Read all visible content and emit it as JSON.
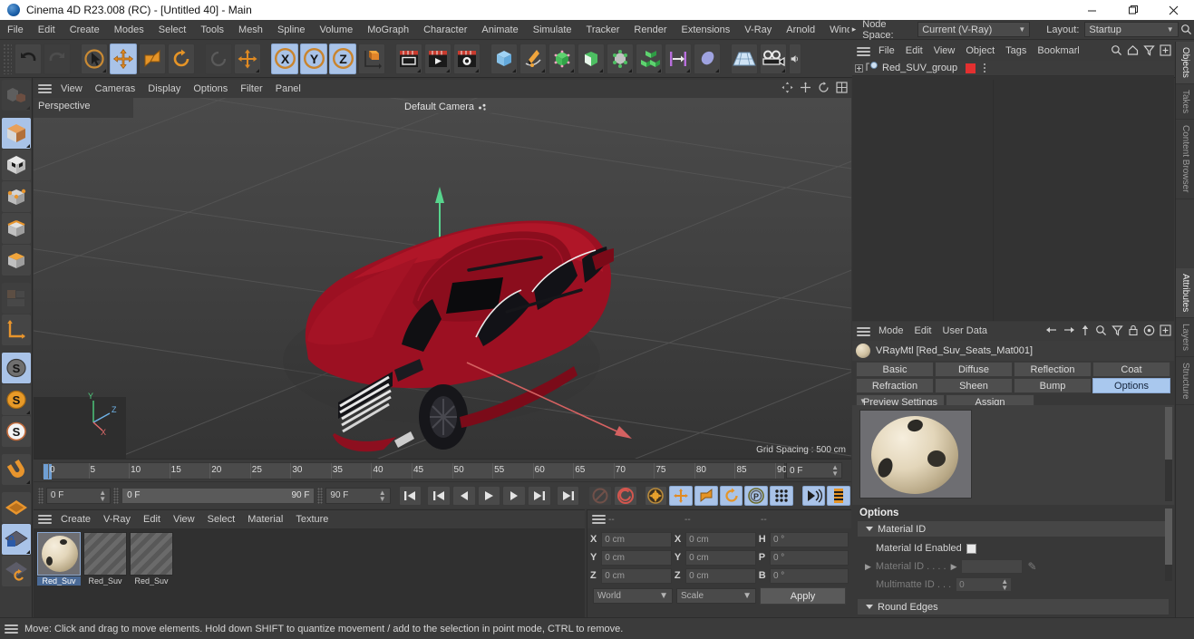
{
  "window": {
    "title": "Cinema 4D R23.008 (RC) - [Untitled 40] - Main",
    "minimize": "—",
    "maximize": "❐",
    "close": "✕"
  },
  "menubar": {
    "items": [
      "File",
      "Edit",
      "Create",
      "Modes",
      "Select",
      "Tools",
      "Mesh",
      "Spline",
      "Volume",
      "MoGraph",
      "Character",
      "Animate",
      "Simulate",
      "Tracker",
      "Render",
      "Extensions",
      "V-Ray",
      "Arnold",
      "Wind"
    ],
    "overflow_arrow": "▸",
    "node_space_label": "Node Space:",
    "node_space_value": "Current (V-Ray)",
    "layout_label": "Layout:",
    "layout_value": "Startup"
  },
  "toolbar": {
    "buttons": [
      {
        "name": "undo",
        "label": "Undo",
        "selected": false,
        "dim": false
      },
      {
        "name": "redo",
        "label": "Redo",
        "selected": false,
        "dim": true
      },
      {
        "name": "select-tool",
        "label": "Live Selection",
        "selected": false,
        "dim": false
      },
      {
        "name": "move-tool",
        "label": "Move",
        "selected": true,
        "dim": false
      },
      {
        "name": "scale-tool",
        "label": "Scale",
        "selected": false,
        "dim": false
      },
      {
        "name": "rotate-tool",
        "label": "Rotate",
        "selected": false,
        "dim": false
      },
      {
        "name": "undo-view",
        "label": "Undo View",
        "selected": false,
        "dim": true
      },
      {
        "name": "move-axis",
        "label": "Move Axis",
        "selected": false,
        "dim": false
      },
      {
        "name": "x-axis",
        "label": "X",
        "selected": true,
        "dim": false
      },
      {
        "name": "y-axis",
        "label": "Y",
        "selected": true,
        "dim": false
      },
      {
        "name": "z-axis",
        "label": "Z",
        "selected": true,
        "dim": false
      },
      {
        "name": "world-coord",
        "label": "World/Object",
        "selected": false,
        "dim": false
      },
      {
        "name": "render-view",
        "label": "Render View",
        "selected": false,
        "dim": false
      },
      {
        "name": "render-picture-viewer",
        "label": "Render to Picture Viewer",
        "selected": false,
        "dim": false
      },
      {
        "name": "render-settings",
        "label": "Render Settings",
        "selected": false,
        "dim": false
      },
      {
        "name": "add-cube",
        "label": "Cube",
        "selected": false,
        "dim": false
      },
      {
        "name": "add-spline",
        "label": "Spline",
        "selected": false,
        "dim": false
      },
      {
        "name": "nurbs",
        "label": "Subdivision Surface",
        "selected": false,
        "dim": false
      },
      {
        "name": "modeling-object",
        "label": "Modeling Object",
        "selected": false,
        "dim": false
      },
      {
        "name": "deformer",
        "label": "Deformer",
        "selected": false,
        "dim": false
      },
      {
        "name": "array",
        "label": "Array",
        "selected": false,
        "dim": false
      },
      {
        "name": "scene-object",
        "label": "Scene Object",
        "selected": false,
        "dim": false
      },
      {
        "name": "light",
        "label": "Light",
        "selected": false,
        "dim": false
      },
      {
        "name": "floor",
        "label": "Floor",
        "selected": false,
        "dim": false
      },
      {
        "name": "camera",
        "label": "Camera",
        "selected": false,
        "dim": false
      },
      {
        "name": "sound",
        "label": "Sound",
        "selected": false,
        "dim": false
      }
    ]
  },
  "left_tools": [
    {
      "name": "make-editable",
      "selected": false,
      "dim": true
    },
    {
      "name": "model-mode",
      "selected": true,
      "dim": false
    },
    {
      "name": "texture-mode",
      "selected": false,
      "dim": false
    },
    {
      "name": "point-mode",
      "selected": false,
      "dim": false
    },
    {
      "name": "edge-mode",
      "selected": false,
      "dim": false
    },
    {
      "name": "polygon-mode",
      "selected": false,
      "dim": false
    },
    {
      "name": "uv-mode",
      "selected": false,
      "dim": true
    },
    {
      "name": "axis-mode",
      "selected": false,
      "dim": false
    },
    {
      "name": "enable-snap",
      "selected": true,
      "dim": false
    },
    {
      "name": "snap-settings",
      "selected": false,
      "dim": false
    },
    {
      "name": "snap-quantize",
      "selected": false,
      "dim": false
    },
    {
      "name": "magnet-tool",
      "selected": false,
      "dim": false
    },
    {
      "name": "workplane",
      "selected": false,
      "dim": false
    },
    {
      "name": "lock-workplane",
      "selected": true,
      "dim": false
    },
    {
      "name": "planar-workplane",
      "selected": false,
      "dim": false
    }
  ],
  "viewport": {
    "menu": [
      "View",
      "Cameras",
      "Display",
      "Options",
      "Filter",
      "Panel"
    ],
    "label": "Perspective",
    "camera": "Default Camera",
    "grid_spacing": "Grid Spacing : 500 cm",
    "icons": [
      "move-view-icon",
      "scale-view-icon",
      "rotate-view-icon",
      "maximize-view-icon"
    ]
  },
  "timeline": {
    "ticks": [
      "0",
      "5",
      "10",
      "15",
      "20",
      "25",
      "30",
      "35",
      "40",
      "45",
      "50",
      "55",
      "60",
      "65",
      "70",
      "75",
      "80",
      "85",
      "90"
    ],
    "current_frame_field": "0 F"
  },
  "transport": {
    "start_field": "0 F",
    "range_start": "0 F",
    "range_end": "90 F",
    "end_field": "90 F",
    "buttons": [
      {
        "name": "go-to-start",
        "glyph": "⏮",
        "selected": false,
        "dim": false
      },
      {
        "name": "step-back-keyframe",
        "glyph": "⏴▏",
        "selected": false,
        "dim": false
      },
      {
        "name": "step-back-frame",
        "glyph": "◀",
        "selected": false,
        "dim": false
      },
      {
        "name": "play",
        "glyph": "▶",
        "selected": false,
        "dim": false
      },
      {
        "name": "step-forward-frame",
        "glyph": "▶",
        "selected": false,
        "dim": false
      },
      {
        "name": "step-forward-keyframe",
        "glyph": "▏▶",
        "selected": false,
        "dim": false
      },
      {
        "name": "go-to-end",
        "glyph": "⏭",
        "selected": false,
        "dim": false
      },
      {
        "name": "record-active-objects",
        "glyph": "⊘",
        "selected": false,
        "dim": true
      },
      {
        "name": "autokeying",
        "glyph": "◎",
        "selected": false,
        "dim": false
      },
      {
        "name": "keyframe-selection",
        "glyph": "⚙",
        "selected": false,
        "dim": false
      },
      {
        "name": "position-key",
        "glyph": "✥",
        "selected": true,
        "dim": false
      },
      {
        "name": "scale-key",
        "glyph": "◰",
        "selected": true,
        "dim": false
      },
      {
        "name": "rotation-key",
        "glyph": "↻",
        "selected": true,
        "dim": false
      },
      {
        "name": "param-key",
        "glyph": "Ⓟ",
        "selected": true,
        "dim": false
      },
      {
        "name": "point-level-animation",
        "glyph": "∷",
        "selected": true,
        "dim": false
      },
      {
        "name": "motion-clip",
        "glyph": "▶)",
        "selected": true,
        "dim": false
      },
      {
        "name": "timeline-toggle",
        "glyph": "☰",
        "selected": false,
        "dim": false
      }
    ]
  },
  "material_manager": {
    "menu": [
      "Create",
      "V-Ray",
      "Edit",
      "View",
      "Select",
      "Material",
      "Texture"
    ],
    "materials": [
      {
        "name": "Red_Suv",
        "selected": true,
        "kind": "sphere"
      },
      {
        "name": "Red_Suv",
        "selected": false,
        "kind": "stripe"
      },
      {
        "name": "Red_Suv",
        "selected": false,
        "kind": "stripe"
      }
    ]
  },
  "coordinates": {
    "headers": [
      "--",
      "--",
      "--"
    ],
    "rows": [
      {
        "axis1": "X",
        "v1": "0 cm",
        "axis2": "X",
        "v2": "0 cm",
        "axis3": "H",
        "v3": "0 °"
      },
      {
        "axis1": "Y",
        "v1": "0 cm",
        "axis2": "Y",
        "v2": "0 cm",
        "axis3": "P",
        "v3": "0 °"
      },
      {
        "axis1": "Z",
        "v1": "0 cm",
        "axis2": "Z",
        "v2": "0 cm",
        "axis3": "B",
        "v3": "0 °"
      }
    ],
    "space": "World",
    "mode": "Scale",
    "apply": "Apply"
  },
  "statusbar": {
    "text": "Move: Click and drag to move elements. Hold down SHIFT to quantize movement / add to the selection in point mode, CTRL to remove."
  },
  "object_manager": {
    "menu": [
      "File",
      "Edit",
      "View",
      "Object",
      "Tags",
      "Bookmarks"
    ],
    "icons": [
      "search-icon",
      "home-icon",
      "filter-icon",
      "add-icon"
    ],
    "rows": [
      {
        "name": "Red_SUV_group",
        "color": "#e33030"
      }
    ]
  },
  "attribute_manager": {
    "menu": [
      "Mode",
      "Edit",
      "User Data"
    ],
    "icons": [
      "back-arrow-icon",
      "forward-arrow-icon",
      "up-arrow-icon",
      "search-icon",
      "filter-icon",
      "lock-icon",
      "target-icon",
      "add-icon"
    ],
    "title": "VRayMtl [Red_Suv_Seats_Mat001]",
    "tabs_row1": [
      "Basic",
      "Diffuse",
      "Reflection",
      "Coat"
    ],
    "tabs_row2": [
      "Refraction",
      "Sheen",
      "Bump",
      "Options"
    ],
    "tabs_row3": [
      "Preview Settings",
      "Assign"
    ],
    "active_tab": "Options",
    "section_title": "Options",
    "groups": [
      {
        "label": "Material ID",
        "rows": [
          {
            "label": "Material Id Enabled",
            "type": "checkbox",
            "checked": false,
            "dimmed": false
          },
          {
            "label": "Material ID . . . .",
            "type": "color",
            "value": "",
            "dimmed": true
          },
          {
            "label": "Multimatte ID . . .",
            "type": "number",
            "value": "0",
            "dimmed": true
          }
        ]
      },
      {
        "label": "Round Edges",
        "rows": []
      }
    ]
  },
  "vertical_tabs": {
    "right_top": [
      "Objects",
      "Takes",
      "Content Browser"
    ],
    "right_bottom": [
      "Attributes",
      "Layers",
      "Structure"
    ],
    "active_top": "Objects",
    "active_bottom": "Attributes"
  },
  "colors": {
    "accent_blue": "#a9c3e8",
    "panel_bg": "#383838",
    "toolbar_bg": "#3b3b3b",
    "car_red": "#9e1020",
    "axis_green": "#5fd48a",
    "axis_red": "#d46060"
  }
}
